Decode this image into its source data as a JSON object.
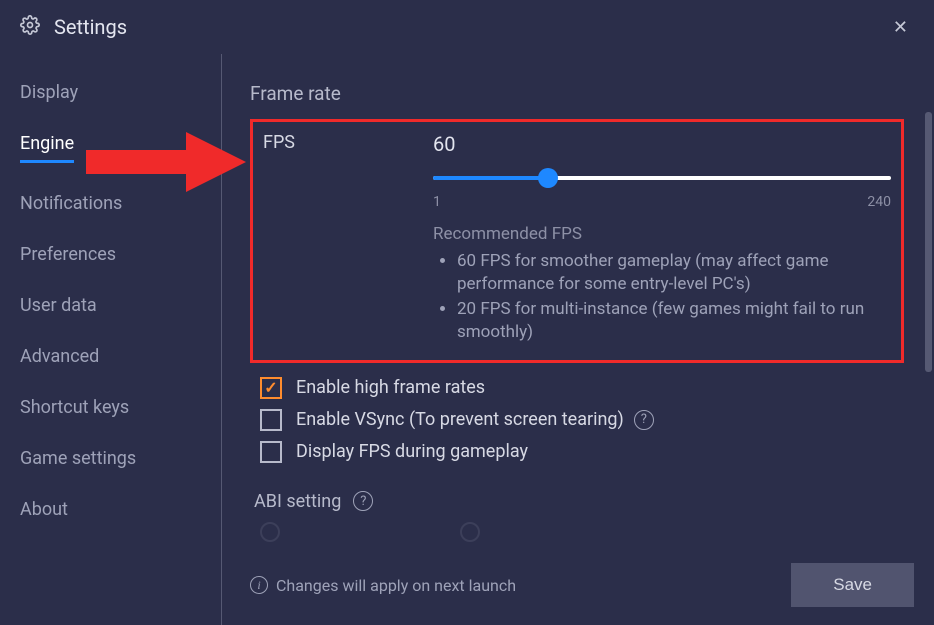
{
  "header": {
    "title": "Settings"
  },
  "sidebar": {
    "items": [
      {
        "label": "Display"
      },
      {
        "label": "Engine"
      },
      {
        "label": "Notifications"
      },
      {
        "label": "Preferences"
      },
      {
        "label": "User data"
      },
      {
        "label": "Advanced"
      },
      {
        "label": "Shortcut keys"
      },
      {
        "label": "Game settings"
      },
      {
        "label": "About"
      }
    ],
    "active_index": 1
  },
  "frame_rate": {
    "section_title": "Frame rate",
    "fps_label": "FPS",
    "fps_value": "60",
    "slider_min": "1",
    "slider_max": "240",
    "recommended_title": "Recommended FPS",
    "recommended_items": [
      "60 FPS for smoother gameplay (may affect game performance for some entry-level PC's)",
      "20 FPS for multi-instance (few games might fail to run smoothly)"
    ]
  },
  "checkboxes": {
    "high_frame": {
      "label": "Enable high frame rates",
      "checked": true
    },
    "vsync": {
      "label": "Enable VSync (To prevent screen tearing)",
      "checked": false
    },
    "display_fps": {
      "label": "Display FPS during gameplay",
      "checked": false
    }
  },
  "abi": {
    "title": "ABI setting"
  },
  "footer": {
    "note": "Changes will apply on next launch",
    "save_label": "Save"
  }
}
